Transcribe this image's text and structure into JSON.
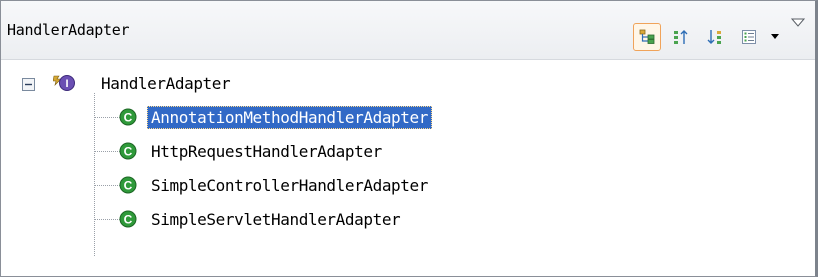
{
  "view": {
    "title": "HandlerAdapter"
  },
  "toolbar": {
    "buttons": [
      {
        "icon": "show-type-hierarchy-icon",
        "pressed": true
      },
      {
        "icon": "show-supertype-hierarchy-icon",
        "pressed": false
      },
      {
        "icon": "show-subtype-hierarchy-icon",
        "pressed": false
      },
      {
        "icon": "layout-icon",
        "pressed": false
      }
    ],
    "dropdown_icon": "dropdown-arrow-icon",
    "view_menu_icon": "view-menu-icon"
  },
  "tree": {
    "root": {
      "label": "HandlerAdapter",
      "icon": "interface-icon",
      "expanded": true
    },
    "children": [
      {
        "label": "AnnotationMethodHandlerAdapter",
        "icon": "class-icon",
        "selected": true
      },
      {
        "label": "HttpRequestHandlerAdapter",
        "icon": "class-icon",
        "selected": false
      },
      {
        "label": "SimpleControllerHandlerAdapter",
        "icon": "class-icon",
        "selected": false
      },
      {
        "label": "SimpleServletHandlerAdapter",
        "icon": "class-icon",
        "selected": false
      }
    ]
  },
  "colors": {
    "selection": "#3169c6",
    "class_icon": "#2f9a3a",
    "interface_icon": "#6b4fb3",
    "pressed_border": "#f0a35a"
  }
}
